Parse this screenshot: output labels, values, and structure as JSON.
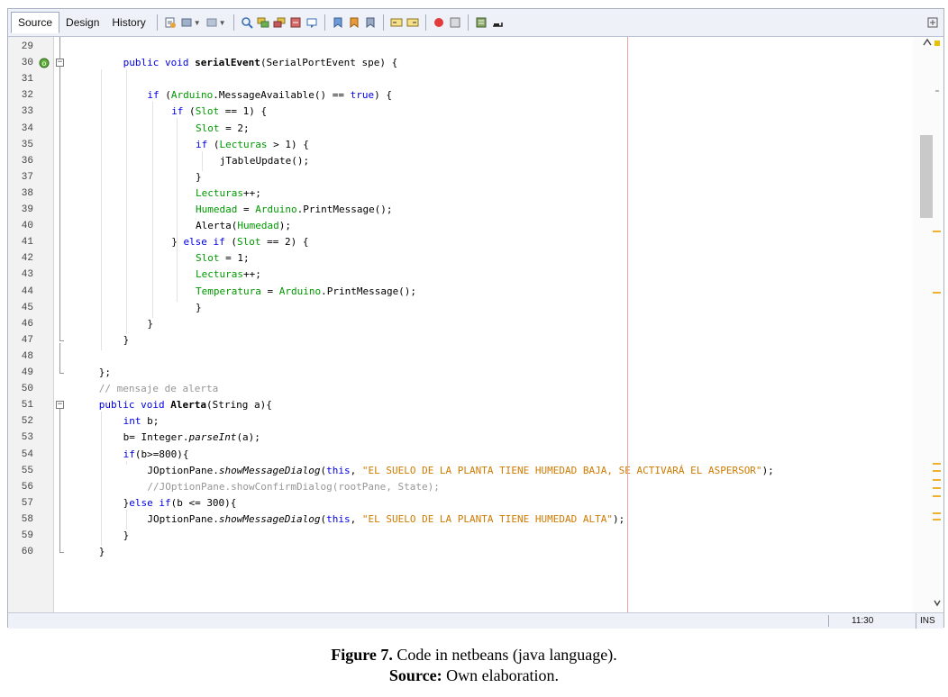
{
  "editor": {
    "tabs": [
      "Source",
      "Design",
      "History"
    ],
    "active_tab": "Source",
    "status": {
      "position": "11:30",
      "mode": "INS"
    },
    "lines": [
      {
        "n": "29",
        "i": 0,
        "t": []
      },
      {
        "n": "30",
        "i": 8,
        "t": [
          [
            "public void ",
            "kw"
          ],
          [
            "serialEvent",
            "bold"
          ],
          [
            "(SerialPortEvent spe) {",
            ""
          ]
        ]
      },
      {
        "n": "31",
        "i": 0,
        "t": []
      },
      {
        "n": "32",
        "i": 12,
        "t": [
          [
            "if",
            "kw"
          ],
          [
            " (",
            ""
          ],
          [
            "Arduino",
            "fld"
          ],
          [
            ".MessageAvailable() == ",
            ""
          ],
          [
            "true",
            "kw"
          ],
          [
            ") {",
            ""
          ]
        ]
      },
      {
        "n": "33",
        "i": 16,
        "t": [
          [
            "if",
            "kw"
          ],
          [
            " (",
            ""
          ],
          [
            "Slot",
            "fld"
          ],
          [
            " == 1) {",
            ""
          ]
        ]
      },
      {
        "n": "34",
        "i": 20,
        "t": [
          [
            "Slot",
            "fld"
          ],
          [
            " = 2;",
            ""
          ]
        ]
      },
      {
        "n": "35",
        "i": 20,
        "t": [
          [
            "if",
            "kw"
          ],
          [
            " (",
            ""
          ],
          [
            "Lecturas",
            "fld"
          ],
          [
            " > 1) {",
            ""
          ]
        ]
      },
      {
        "n": "36",
        "i": 24,
        "t": [
          [
            "jTableUpdate();",
            ""
          ]
        ]
      },
      {
        "n": "37",
        "i": 20,
        "t": [
          [
            "}",
            ""
          ]
        ]
      },
      {
        "n": "38",
        "i": 20,
        "t": [
          [
            "Lecturas",
            "fld"
          ],
          [
            "++;",
            ""
          ]
        ]
      },
      {
        "n": "39",
        "i": 20,
        "t": [
          [
            "Humedad",
            "fld"
          ],
          [
            " = ",
            ""
          ],
          [
            "Arduino",
            "fld"
          ],
          [
            ".PrintMessage();",
            ""
          ]
        ]
      },
      {
        "n": "40",
        "i": 20,
        "t": [
          [
            "Alerta(",
            ""
          ],
          [
            "Humedad",
            "fld"
          ],
          [
            ");",
            ""
          ]
        ]
      },
      {
        "n": "41",
        "i": 16,
        "t": [
          [
            "} ",
            ""
          ],
          [
            "else if",
            "kw"
          ],
          [
            " (",
            ""
          ],
          [
            "Slot",
            "fld"
          ],
          [
            " == 2) {",
            ""
          ]
        ]
      },
      {
        "n": "42",
        "i": 20,
        "t": [
          [
            "Slot",
            "fld"
          ],
          [
            " = 1;",
            ""
          ]
        ]
      },
      {
        "n": "43",
        "i": 20,
        "t": [
          [
            "Lecturas",
            "fld"
          ],
          [
            "++;",
            ""
          ]
        ]
      },
      {
        "n": "44",
        "i": 20,
        "t": [
          [
            "Temperatura",
            "fld"
          ],
          [
            " = ",
            ""
          ],
          [
            "Arduino",
            "fld"
          ],
          [
            ".PrintMessage();",
            ""
          ]
        ]
      },
      {
        "n": "45",
        "i": 20,
        "t": [
          [
            "}",
            ""
          ]
        ]
      },
      {
        "n": "46",
        "i": 12,
        "t": [
          [
            "}",
            ""
          ]
        ]
      },
      {
        "n": "47",
        "i": 8,
        "t": [
          [
            "}",
            ""
          ]
        ]
      },
      {
        "n": "48",
        "i": 0,
        "t": []
      },
      {
        "n": "49",
        "i": 4,
        "t": [
          [
            "};",
            ""
          ]
        ]
      },
      {
        "n": "50",
        "i": 4,
        "t": [
          [
            "// mensaje de alerta",
            "cmt"
          ]
        ]
      },
      {
        "n": "51",
        "i": 4,
        "t": [
          [
            "public void ",
            "kw"
          ],
          [
            "Alerta",
            "bold"
          ],
          [
            "(String a){",
            ""
          ]
        ]
      },
      {
        "n": "52",
        "i": 8,
        "t": [
          [
            "int",
            "kw"
          ],
          [
            " b;",
            ""
          ]
        ]
      },
      {
        "n": "53",
        "i": 8,
        "t": [
          [
            "b= Integer.",
            ""
          ],
          [
            "parseInt",
            "ital"
          ],
          [
            "(a);",
            ""
          ]
        ]
      },
      {
        "n": "54",
        "i": 8,
        "t": [
          [
            "if",
            "kw"
          ],
          [
            "(b>=800){",
            ""
          ]
        ]
      },
      {
        "n": "55",
        "i": 12,
        "t": [
          [
            "JOptionPane.",
            ""
          ],
          [
            "showMessageDialog",
            "ital"
          ],
          [
            "(",
            ""
          ],
          [
            "this",
            "kw"
          ],
          [
            ", ",
            ""
          ],
          [
            "\"EL SUELO DE LA PLANTA TIENE HUMEDAD BAJA, SE ACTIVARÁ EL ASPERSOR\"",
            "str"
          ],
          [
            ");",
            ""
          ]
        ]
      },
      {
        "n": "56",
        "i": 12,
        "t": [
          [
            "//JOptionPane.showConfirmDialog(rootPane, State);",
            "cmt"
          ]
        ]
      },
      {
        "n": "57",
        "i": 8,
        "t": [
          [
            "}",
            ""
          ],
          [
            "else if",
            "kw"
          ],
          [
            "(b <= 300){",
            ""
          ]
        ]
      },
      {
        "n": "58",
        "i": 12,
        "t": [
          [
            "JOptionPane.",
            ""
          ],
          [
            "showMessageDialog",
            "ital"
          ],
          [
            "(",
            ""
          ],
          [
            "this",
            "kw"
          ],
          [
            ", ",
            ""
          ],
          [
            "\"EL SUELO DE LA PLANTA TIENE HUMEDAD ALTA\"",
            "str"
          ],
          [
            ");",
            ""
          ]
        ]
      },
      {
        "n": "59",
        "i": 8,
        "t": [
          [
            "}",
            ""
          ]
        ]
      },
      {
        "n": "60",
        "i": 4,
        "t": [
          [
            "}",
            ""
          ]
        ]
      }
    ]
  },
  "caption": {
    "figure_label": "Figure 7.",
    "figure_text": " Code in netbeans (java language).",
    "source_label": "Source:",
    "source_text": " Own elaboration."
  },
  "colors": {
    "keyword": "#0000e6",
    "field": "#009900",
    "string": "#ce7b00",
    "comment": "#969696",
    "margin_line": "#f1a3a3"
  }
}
